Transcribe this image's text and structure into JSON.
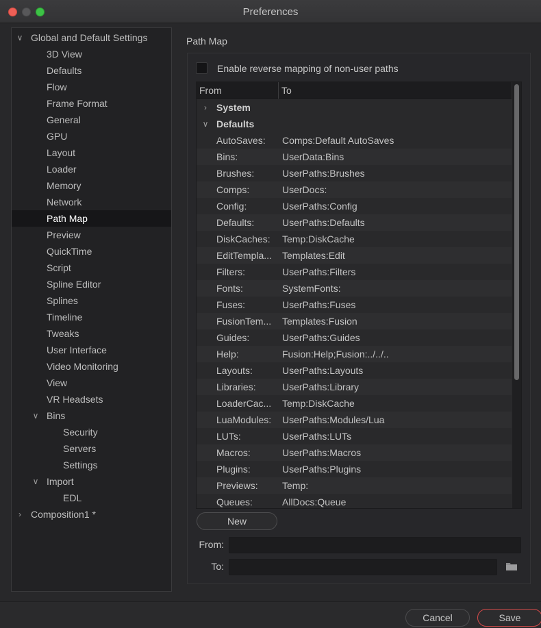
{
  "window": {
    "title": "Preferences"
  },
  "sidebar": {
    "items": [
      {
        "label": "Global and Default Settings",
        "level": 0,
        "expanded": true
      },
      {
        "label": "3D View",
        "level": 1
      },
      {
        "label": "Defaults",
        "level": 1
      },
      {
        "label": "Flow",
        "level": 1
      },
      {
        "label": "Frame Format",
        "level": 1
      },
      {
        "label": "General",
        "level": 1
      },
      {
        "label": "GPU",
        "level": 1
      },
      {
        "label": "Layout",
        "level": 1
      },
      {
        "label": "Loader",
        "level": 1
      },
      {
        "label": "Memory",
        "level": 1
      },
      {
        "label": "Network",
        "level": 1
      },
      {
        "label": "Path Map",
        "level": 1,
        "selected": true
      },
      {
        "label": "Preview",
        "level": 1
      },
      {
        "label": "QuickTime",
        "level": 1
      },
      {
        "label": "Script",
        "level": 1
      },
      {
        "label": "Spline Editor",
        "level": 1
      },
      {
        "label": "Splines",
        "level": 1
      },
      {
        "label": "Timeline",
        "level": 1
      },
      {
        "label": "Tweaks",
        "level": 1
      },
      {
        "label": "User Interface",
        "level": 1
      },
      {
        "label": "Video Monitoring",
        "level": 1
      },
      {
        "label": "View",
        "level": 1
      },
      {
        "label": "VR Headsets",
        "level": 1
      },
      {
        "label": "Bins",
        "level": 1,
        "expanded": true
      },
      {
        "label": "Security",
        "level": 2
      },
      {
        "label": "Servers",
        "level": 2
      },
      {
        "label": "Settings",
        "level": 2
      },
      {
        "label": "Import",
        "level": 1,
        "expanded": true
      },
      {
        "label": "EDL",
        "level": 2
      },
      {
        "label": "Composition1 *",
        "level": 0,
        "expanded": false
      }
    ]
  },
  "panel": {
    "title": "Path Map",
    "reverse_mapping": {
      "label": "Enable reverse mapping of non-user paths",
      "checked": false
    }
  },
  "table": {
    "columns": {
      "from": "From",
      "to": "To"
    },
    "groups": [
      {
        "label": "System",
        "expanded": false
      },
      {
        "label": "Defaults",
        "expanded": true
      }
    ],
    "rows": [
      {
        "from": "AutoSaves:",
        "to": "Comps:Default AutoSaves"
      },
      {
        "from": "Bins:",
        "to": "UserData:Bins"
      },
      {
        "from": "Brushes:",
        "to": "UserPaths:Brushes"
      },
      {
        "from": "Comps:",
        "to": "UserDocs:"
      },
      {
        "from": "Config:",
        "to": "UserPaths:Config"
      },
      {
        "from": "Defaults:",
        "to": "UserPaths:Defaults"
      },
      {
        "from": "DiskCaches:",
        "to": "Temp:DiskCache"
      },
      {
        "from": "EditTempla...",
        "to": "Templates:Edit"
      },
      {
        "from": "Filters:",
        "to": "UserPaths:Filters"
      },
      {
        "from": "Fonts:",
        "to": "SystemFonts:"
      },
      {
        "from": "Fuses:",
        "to": "UserPaths:Fuses"
      },
      {
        "from": "FusionTem...",
        "to": "Templates:Fusion"
      },
      {
        "from": "Guides:",
        "to": "UserPaths:Guides"
      },
      {
        "from": "Help:",
        "to": "Fusion:Help;Fusion:../../.."
      },
      {
        "from": "Layouts:",
        "to": "UserPaths:Layouts"
      },
      {
        "from": "Libraries:",
        "to": "UserPaths:Library"
      },
      {
        "from": "LoaderCac...",
        "to": "Temp:DiskCache"
      },
      {
        "from": "LuaModules:",
        "to": "UserPaths:Modules/Lua"
      },
      {
        "from": "LUTs:",
        "to": "UserPaths:LUTs"
      },
      {
        "from": "Macros:",
        "to": "UserPaths:Macros"
      },
      {
        "from": "Plugins:",
        "to": "UserPaths:Plugins"
      },
      {
        "from": "Previews:",
        "to": "Temp:"
      },
      {
        "from": "Queues:",
        "to": "AllDocs:Queue"
      }
    ]
  },
  "buttons": {
    "new": "New",
    "cancel": "Cancel",
    "save": "Save"
  },
  "fields": {
    "from": {
      "label": "From:",
      "value": ""
    },
    "to": {
      "label": "To:",
      "value": ""
    }
  },
  "icons": {
    "folder": "folder-icon",
    "chevron_right": "chevron-right-icon",
    "chevron_down": "chevron-down-icon"
  },
  "colors": {
    "close": "#ee5f56",
    "minimize": "#58585a",
    "maximize": "#3dc246",
    "save_border": "#d64a4a",
    "selection": "#161618"
  }
}
